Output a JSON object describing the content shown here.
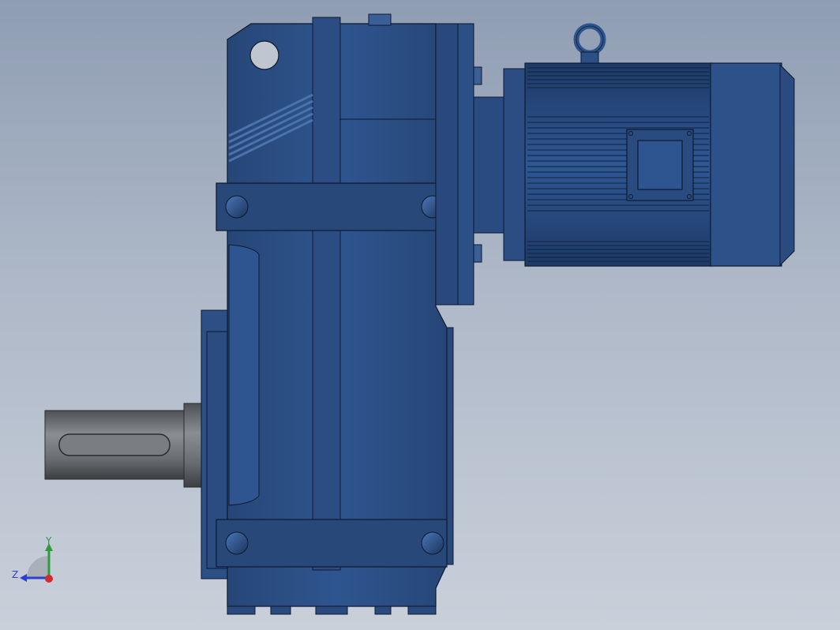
{
  "viewport": {
    "background_top": "#8f9db3",
    "background_bottom": "#c9d0da"
  },
  "model": {
    "housing_color": "#2c4f86",
    "housing_dark": "#1f3c6b",
    "housing_light": "#3f69a6",
    "shaft_color": "#707378",
    "outline_color": "#0d1a30"
  },
  "triad": {
    "y_label": "Y",
    "z_label": "Z",
    "y_color": "#2e9a3c",
    "z_color": "#2b3fd1",
    "x_color": "#d42a2a"
  }
}
